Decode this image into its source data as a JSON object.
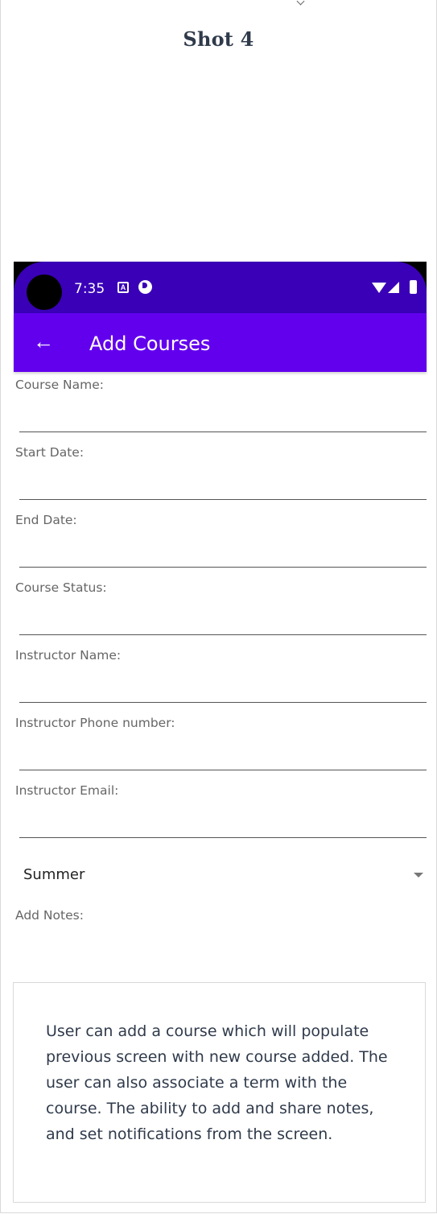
{
  "page": {
    "title": "Shot 4"
  },
  "status_bar": {
    "time": "7:35"
  },
  "app_bar": {
    "title": "Add Courses"
  },
  "form": {
    "fields": [
      {
        "label": "Course Name:",
        "value": ""
      },
      {
        "label": "Start Date:",
        "value": ""
      },
      {
        "label": "End Date:",
        "value": ""
      },
      {
        "label": "Course Status:",
        "value": ""
      },
      {
        "label": "Instructor Name:",
        "value": ""
      },
      {
        "label": "Instructor Phone number:",
        "value": ""
      },
      {
        "label": "Instructor Email:",
        "value": ""
      }
    ],
    "term_select": {
      "selected": "Summer"
    },
    "notes_label": "Add Notes:"
  },
  "description": "User can add a course which will populate previous screen with new course added. The user can also associate a term with the course. The ability to add and share notes, and set notifications from the screen.",
  "colors": {
    "app_bar": "#6200ee",
    "status_bar": "#3a00b7",
    "heading_text": "#2f3a4b"
  },
  "icons": {
    "back": "arrow-back-icon",
    "dropdown": "chevron-down-icon",
    "wifi": "wifi-icon",
    "signal": "signal-icon",
    "battery": "battery-icon"
  }
}
